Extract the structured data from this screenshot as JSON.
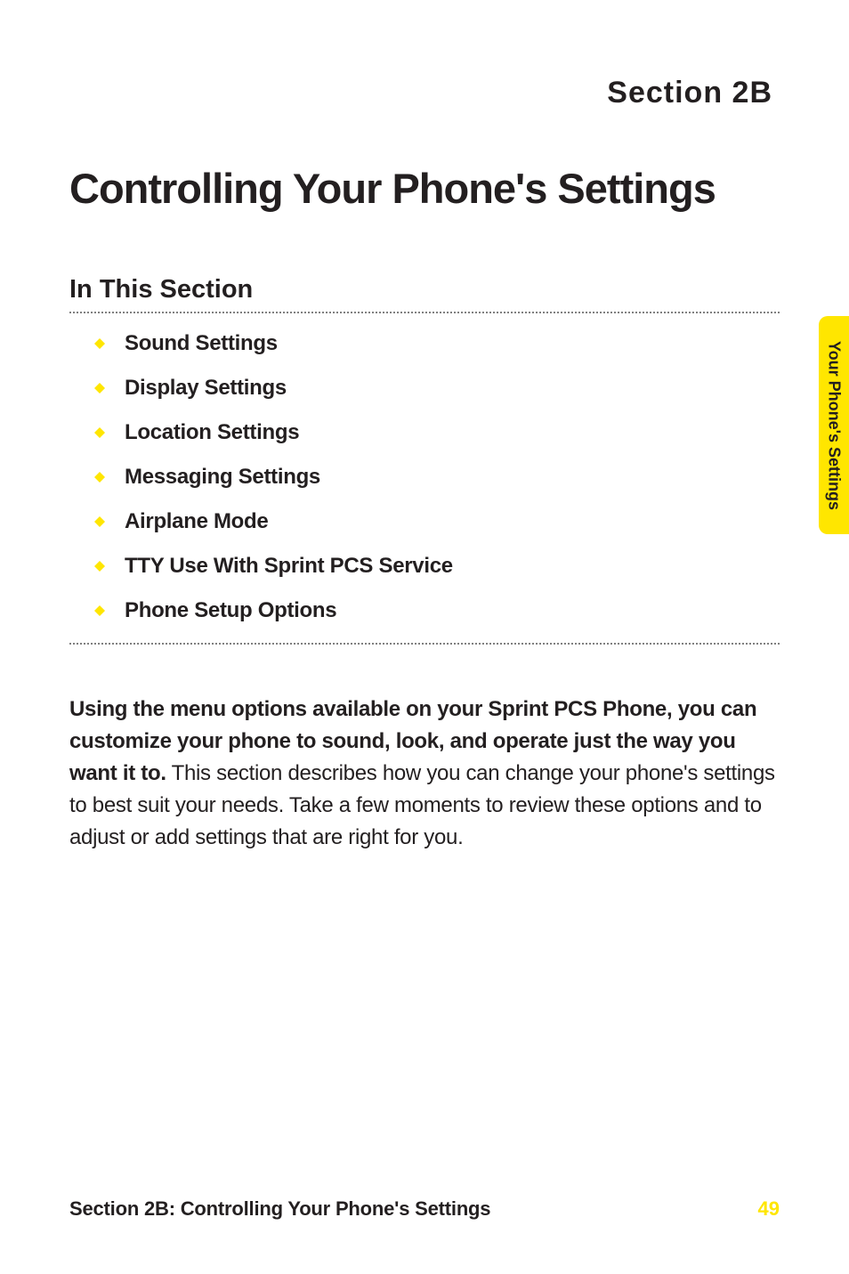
{
  "section_label": "Section 2B",
  "chapter_title": "Controlling Your Phone's Settings",
  "in_this_section": "In This Section",
  "toc": [
    {
      "label": "Sound Settings"
    },
    {
      "label": "Display Settings"
    },
    {
      "label": "Location Settings"
    },
    {
      "label": "Messaging Settings"
    },
    {
      "label": "Airplane Mode"
    },
    {
      "label": "TTY Use With Sprint PCS Service"
    },
    {
      "label": "Phone Setup Options"
    }
  ],
  "body_bold": "Using the menu options available on your Sprint PCS Phone, you can customize your phone to sound, look, and operate just the way you want it to.",
  "body_regular": " This section describes how you can change your phone's settings to best suit your needs. Take a few moments to review these options and to adjust or add settings that are right for you.",
  "side_tab": "Your Phone's Settings",
  "footer_title": "Section 2B: Controlling Your Phone's Settings",
  "page_number": "49",
  "diamond_color": "#ffe600"
}
